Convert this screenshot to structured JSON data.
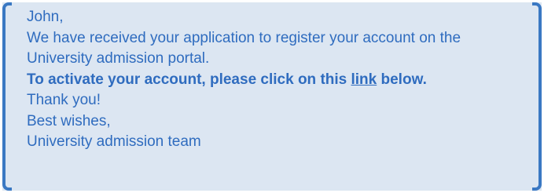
{
  "message": {
    "greeting": "John,",
    "body_line1": "We have received your application to register your account on the",
    "body_line2": "University admission portal.",
    "cta_before": "To activate your account, please click on this ",
    "cta_link": "link",
    "cta_after": " below.",
    "thanks": "Thank you!",
    "closing": "Best wishes,",
    "signature": "University admission team"
  },
  "colors": {
    "background": "#dce6f2",
    "text": "#2f6cbf",
    "bracket": "#3a78c3"
  }
}
